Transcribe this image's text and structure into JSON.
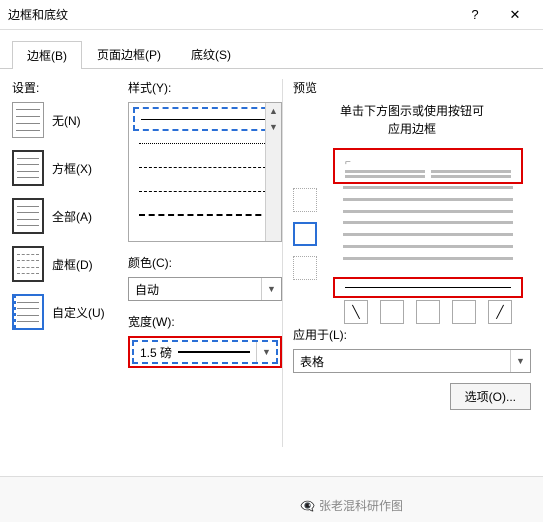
{
  "title": "边框和底纹",
  "tabs": {
    "border": "边框(B)",
    "page": "页面边框(P)",
    "shading": "底纹(S)"
  },
  "col1": {
    "label": "设置:",
    "items": [
      {
        "label": "无(N)"
      },
      {
        "label": "方框(X)"
      },
      {
        "label": "全部(A)"
      },
      {
        "label": "虚框(D)"
      },
      {
        "label": "自定义(U)"
      }
    ]
  },
  "col2": {
    "style_label": "样式(Y):",
    "color_label": "颜色(C):",
    "color_value": "自动",
    "width_label": "宽度(W):",
    "width_value": "1.5 磅"
  },
  "preview": {
    "label": "预览",
    "hint1": "单击下方图示或使用按钮可",
    "hint2": "应用边框",
    "apply_label": "应用于(L):",
    "apply_value": "表格",
    "options_btn": "选项(O)..."
  },
  "footer": {
    "watermark": "张老混科研作图"
  }
}
